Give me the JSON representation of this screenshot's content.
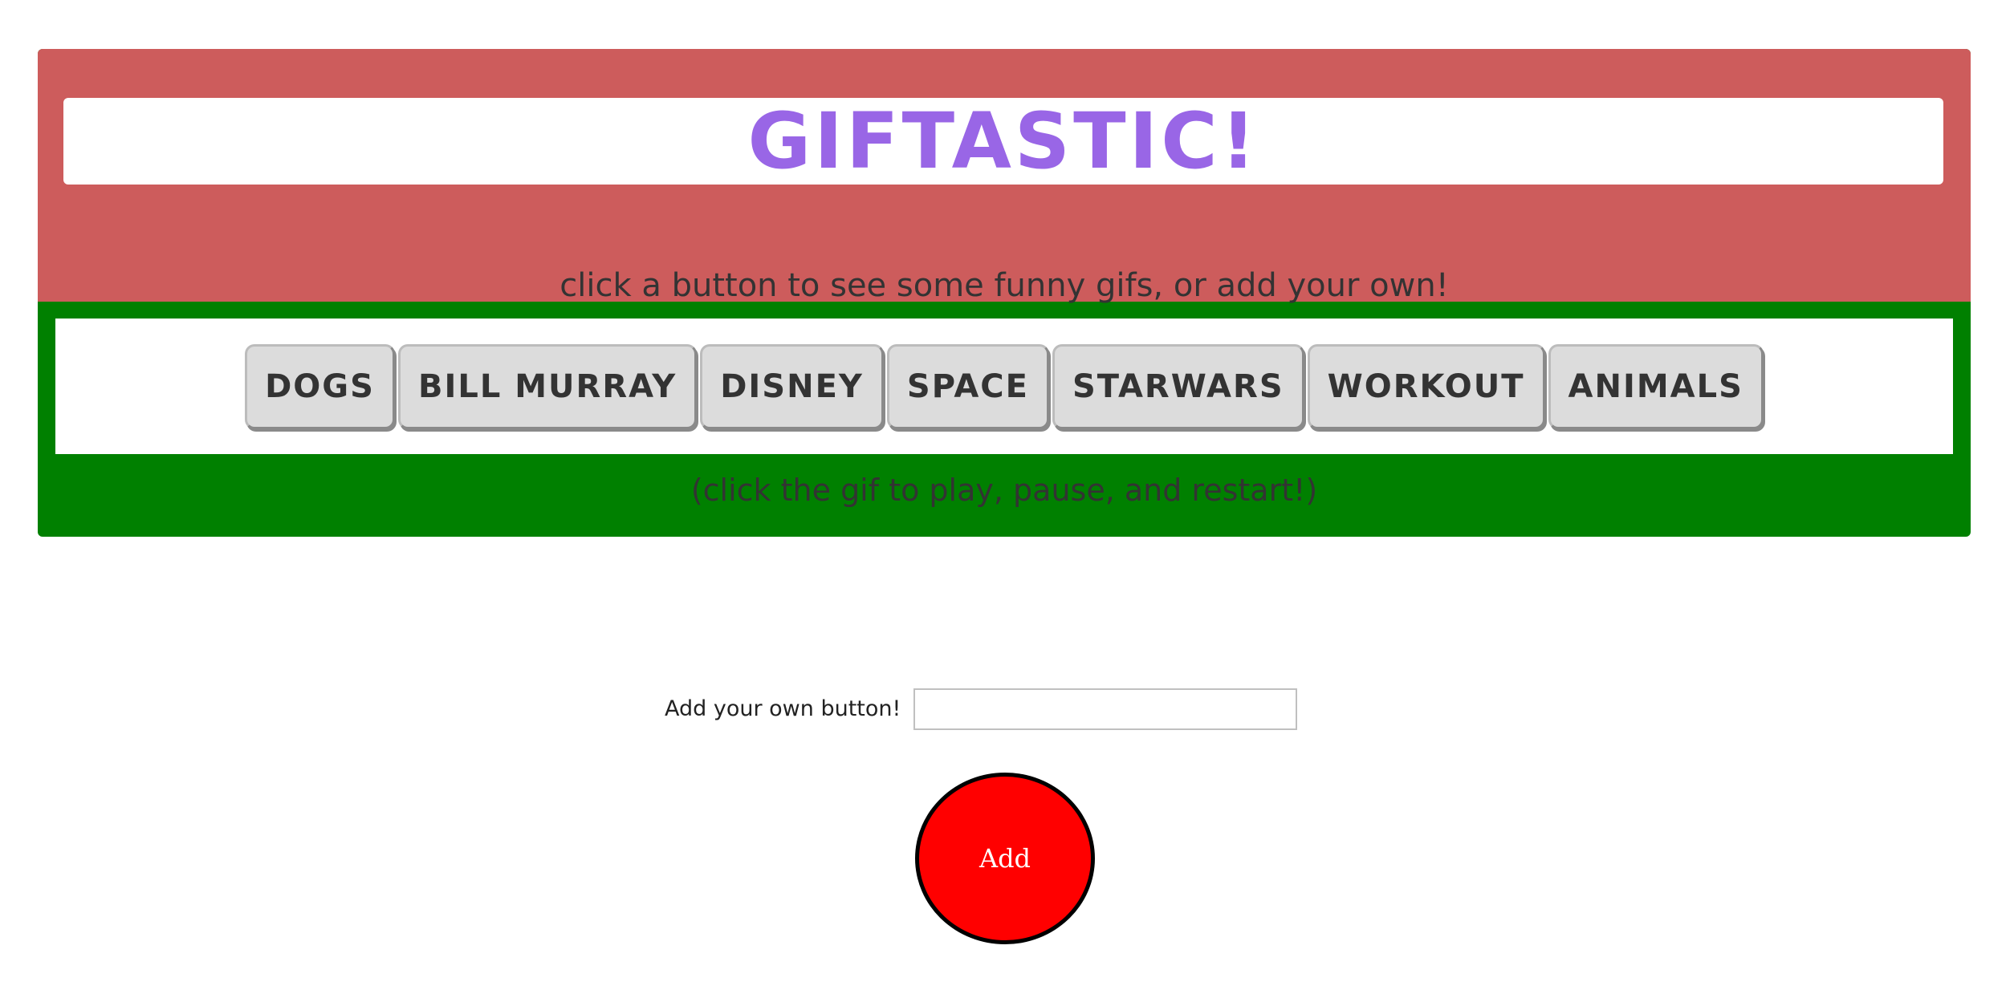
{
  "header": {
    "title": "GIFTASTIC!",
    "subtitle": "click a button to see some funny gifs, or add your own!"
  },
  "topics": [
    {
      "label": "DOGS"
    },
    {
      "label": "BILL MURRAY"
    },
    {
      "label": "DISNEY"
    },
    {
      "label": "SPACE"
    },
    {
      "label": "STARWARS"
    },
    {
      "label": "WORKOUT"
    },
    {
      "label": "ANIMALS"
    }
  ],
  "hint": "(click the gif to play, pause, and restart!)",
  "add_form": {
    "label": "Add your own button!",
    "input_value": "",
    "button_label": "Add"
  },
  "colors": {
    "header_bg": "#cd5c5c",
    "panel_bg": "#008000",
    "title_color": "#9966e6",
    "add_button_bg": "#ff0000"
  }
}
